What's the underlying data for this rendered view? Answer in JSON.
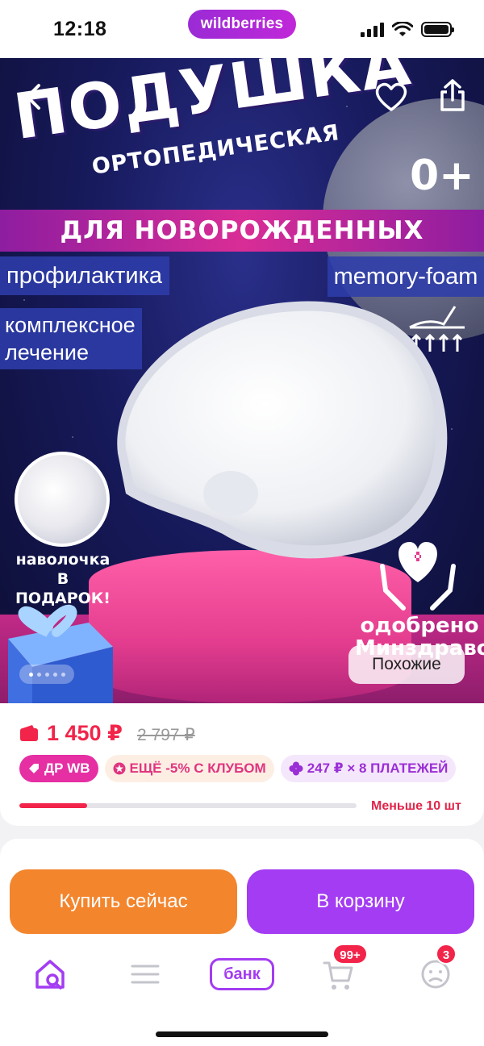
{
  "status_bar": {
    "time": "12:18",
    "brand": "wildberries"
  },
  "hero": {
    "title": "ПОДУШКА",
    "subtitle": "ОРТОПЕДИЧЕСКАЯ",
    "age": "0+",
    "banner": "ДЛЯ НОВОРОЖДЕННЫХ",
    "tag_prevention": "профилактика",
    "tag_treatment": "комплексное лечение",
    "tag_material": "memory-foam",
    "gift_text": "наволочка В ПОДАРОК!",
    "approved_text": "одобрено Минздравом",
    "similar_button": "Похожие",
    "gallery_total": 5,
    "gallery_current": 1
  },
  "price": {
    "current": "1 450 ₽",
    "old": "2 797 ₽",
    "badges": {
      "dr": "ДР WB",
      "club": "ЕЩЁ -5% С КЛУБОМ",
      "installments": "247 ₽ × 8 ПЛАТЕЖЕЙ"
    },
    "stock_fraction": 0.2,
    "stock_text": "Меньше 10 шт"
  },
  "actions": {
    "buy_now": "Купить сейчас",
    "add_to_cart": "В корзину"
  },
  "tabbar": {
    "bank": "банк",
    "cart_badge": "99+",
    "profile_badge": "3"
  },
  "colors": {
    "accent_purple": "#a33cf2",
    "buy_orange": "#f3852d",
    "price_red": "#f2244a",
    "brand_pink": "#e52fa3"
  }
}
